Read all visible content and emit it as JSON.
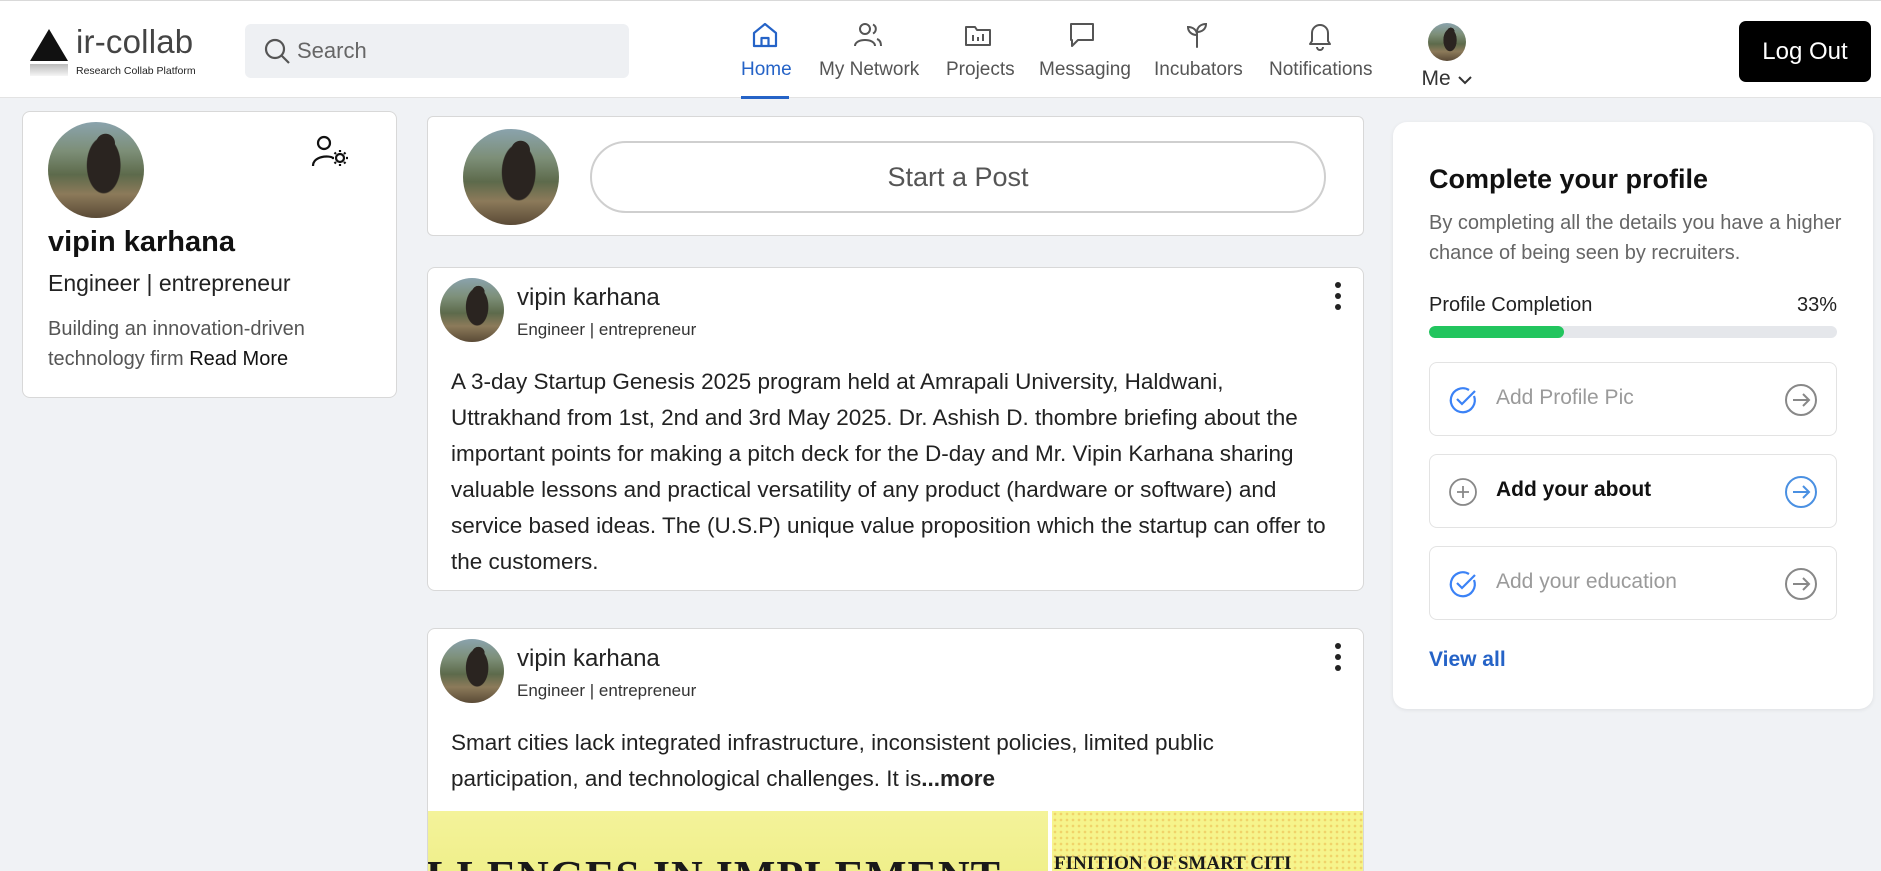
{
  "app": {
    "logo_text": "ir-collab",
    "logo_subtitle": "Research Collab Platform"
  },
  "search": {
    "placeholder": "Search",
    "icon": "search-icon"
  },
  "nav": {
    "items": [
      {
        "label": "Home",
        "icon": "home-icon",
        "active": true
      },
      {
        "label": "My Network",
        "icon": "users-icon",
        "active": false
      },
      {
        "label": "Projects",
        "icon": "folder-icon",
        "active": false
      },
      {
        "label": "Messaging",
        "icon": "chat-icon",
        "active": false
      },
      {
        "label": "Incubators",
        "icon": "sprout-icon",
        "active": false
      },
      {
        "label": "Notifications",
        "icon": "bell-icon",
        "active": false
      }
    ],
    "me_label": "Me",
    "logout_label": "Log Out",
    "active_color": "#2563c7"
  },
  "profile": {
    "name": "vipin karhana",
    "title": "Engineer | entrepreneur",
    "bio": "Building an innovation-driven technology firm",
    "read_more": "Read More"
  },
  "composer": {
    "button_label": "Start a Post"
  },
  "posts": [
    {
      "author": "vipin karhana",
      "subtitle": "Engineer | entrepreneur",
      "text": "A 3-day Startup Genesis 2025 program held at Amrapali University, Haldwani, Uttrakhand from 1st, 2nd and 3rd May 2025. Dr. Ashish D. thombre briefing about the important points for making a pitch deck for the D-day and Mr. Vipin Karhana sharing valuable lessons and practical versatility of any product (hardware or software) and service based ideas. The (U.S.P) unique value proposition which the startup can offer to the customers."
    },
    {
      "author": "vipin karhana",
      "subtitle": "Engineer | entrepreneur",
      "text": "Smart cities lack integrated infrastructure, inconsistent policies, limited public participation, and technological challenges. It is",
      "more_label": "...more",
      "image_left_text": "LLENGES IN IMPLEMENT",
      "image_right_text": "FINITION OF SMART CITI"
    }
  ],
  "complete_profile": {
    "title": "Complete your profile",
    "description": "By completing all the details you have a higher chance of being seen by recruiters.",
    "progress_label": "Profile Completion",
    "progress_value": 33,
    "progress_text": "33%",
    "progress_color": "#22c55e",
    "items": [
      {
        "label": "Add Profile Pic",
        "done": true
      },
      {
        "label": "Add your about",
        "done": false
      },
      {
        "label": "Add your education",
        "done": true
      }
    ],
    "view_all": "View all"
  }
}
